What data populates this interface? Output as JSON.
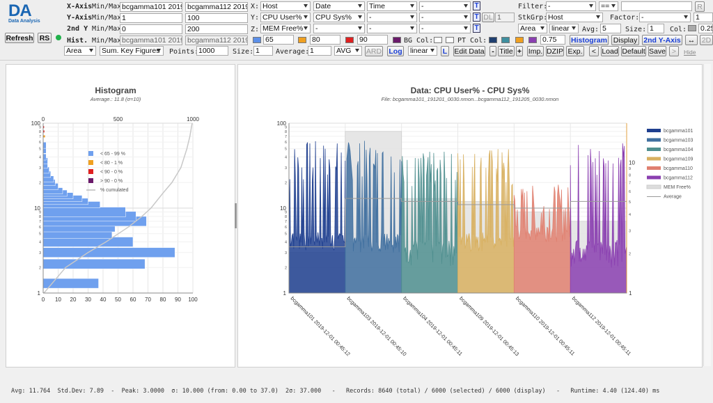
{
  "logo": {
    "text": "DA",
    "sub": "Data Analysis"
  },
  "buttons": {
    "refresh": "Refresh",
    "rs": "RS",
    "t": "T",
    "dl": "DL",
    "histogram": "Histogram",
    "display": "Display",
    "second_y": "2nd Y-Axis",
    "arrows": "↔",
    "twod": "2D",
    "r": "R",
    "ard": "ARD",
    "log": "Log",
    "l": "L",
    "edit_data": "Edit Data",
    "minus": "-",
    "title": "Title",
    "plus": "+",
    "imp": "Imp.",
    "dzip": "DZIP",
    "exp": "Exp.",
    "lt": "<",
    "load": "Load",
    "default": "Default",
    "save": "Save",
    "gt": ">",
    "hide": "Hide"
  },
  "axes_rows": [
    {
      "label": "X-Axis",
      "minmax": "Min/Max",
      "min": "bcgamma101 2019-",
      "max": "bcgamma112 2019-",
      "min_grey": false
    },
    {
      "label": "Y-Axis",
      "minmax": "Min/Max",
      "min": "1",
      "max": "100",
      "min_grey": false
    },
    {
      "label": "2nd Y",
      "minmax": "Min/Max",
      "min": "0",
      "max": "200",
      "min_grey": false
    },
    {
      "label": "Hist.",
      "minmax": "Min/Max",
      "min": "bcgamma101 2019-",
      "max": "bcgamma112 2019-",
      "min_grey": true
    }
  ],
  "xyz": {
    "x_label": "X:",
    "y_label": "Y:",
    "z_label": "Z:",
    "x": [
      "Host",
      "Date",
      "Time",
      "-"
    ],
    "y": [
      "CPU User%",
      "CPU Sys%",
      "-",
      "-"
    ],
    "z": [
      "MEM Free%",
      "-",
      "-",
      "-"
    ],
    "dl_value": "1"
  },
  "filter": {
    "label": "Filter:",
    "field": "-",
    "op": "==",
    "value": ""
  },
  "stkgrp": {
    "label": "StkGrp:",
    "value": "Host",
    "factor_label": "Factor:",
    "factor": "-",
    "factor_value": "1"
  },
  "area_row": {
    "mode": "Area",
    "scale": "linear",
    "avg_label": "Avg:",
    "avg": "5",
    "size_label": "Size:",
    "size": "1",
    "col_label": "Col:",
    "col_value": "0.25"
  },
  "thresholds": {
    "v1": "65",
    "v2": "80",
    "v3": "90",
    "c1": "#5b8fe8",
    "c2": "#f0a020",
    "c3": "#e02020",
    "c4": "#6a1a6a",
    "bg_label": "BG Col:",
    "pt_label": "PT Col:",
    "pt_value": "0.75"
  },
  "row5": {
    "type": "Area",
    "keyfig": "Sum. Key Figures",
    "points_label": "Points:",
    "points": "1000",
    "size_label": "Size:",
    "size": "1",
    "average_label": "Average:",
    "average": "1",
    "agg": "AVG",
    "interp": "linear"
  },
  "histogram": {
    "title": "Histogram",
    "subtitle": "Average.: 11.8 (σ=10)",
    "top_ticks": [
      "0",
      "500",
      "1000"
    ],
    "bottom_ticks": [
      "0",
      "10",
      "20",
      "30",
      "40",
      "50",
      "60",
      "70",
      "80",
      "90",
      "100"
    ],
    "left_ticks": [
      "1",
      "10",
      "100"
    ],
    "left_minor": [
      "2",
      "3",
      "4",
      "5",
      "6",
      "7",
      "8",
      "9"
    ],
    "legend": [
      {
        "label": "< 65 - 99 %",
        "color": "#6fa0ee"
      },
      {
        "label": "< 80 - 1 %",
        "color": "#f0a020"
      },
      {
        "label": "< 90 - 0 %",
        "color": "#e02020"
      },
      {
        "label": "> 90 - 0 %",
        "color": "#6a1a6a"
      },
      {
        "label": "% cumulated",
        "color": "#bbbbbb"
      }
    ]
  },
  "main_chart": {
    "title": "Data: CPU User% - CPU Sys%",
    "subtitle": "File: bcgamma101_191201_0030.nmon...bcgamma112_191205_0030.nmon",
    "left_ticks": [
      "1",
      "10",
      "100"
    ],
    "left_minor": [
      "2",
      "3",
      "4",
      "5",
      "6",
      "7",
      "8",
      "9"
    ],
    "right_ticks": [
      "1",
      "10"
    ],
    "right_minor": [
      "2",
      "3",
      "4",
      "5",
      "6",
      "7",
      "8",
      "9"
    ],
    "x_labels": [
      "bcgamma101 2019-12-01 00:45:12",
      "bcgamma103 2019-12-01 00:45:10",
      "bcgamma104 2019-12-01 00:45:11",
      "bcgamma109 2019-12-01 00:45:13",
      "bcgamma110 2019-12-01 00:45:11",
      "bcgamma112 2019-12-01 00:45:11"
    ],
    "legend": [
      {
        "label": "bcgamma101",
        "color": "#1f3f8f"
      },
      {
        "label": "bcgamma103",
        "color": "#3f6f9f"
      },
      {
        "label": "bcgamma104",
        "color": "#4f8f8f"
      },
      {
        "label": "bcgamma109",
        "color": "#d8b060"
      },
      {
        "label": "bcgamma110",
        "color": "#e08070"
      },
      {
        "label": "bcgamma112",
        "color": "#8a3fb0"
      },
      {
        "label": "MEM Free%",
        "color": "#dddddd"
      },
      {
        "label": "Average",
        "color": "#999999"
      }
    ]
  },
  "chart_data": [
    {
      "type": "bar",
      "title": "Histogram",
      "subtitle": "Average.: 11.8 (σ=10)",
      "orientation": "horizontal",
      "xlim": [
        0,
        100
      ],
      "y_scale": "log",
      "ylim": [
        1,
        100
      ],
      "bins": [
        {
          "y": 1.3,
          "value": 37
        },
        {
          "y": 2.2,
          "value": 68
        },
        {
          "y": 3.0,
          "value": 88
        },
        {
          "y": 4.0,
          "value": 60
        },
        {
          "y": 5.0,
          "value": 46
        },
        {
          "y": 6.0,
          "value": 48
        },
        {
          "y": 7.0,
          "value": 69
        },
        {
          "y": 8.0,
          "value": 62
        },
        {
          "y": 9.0,
          "value": 55
        },
        {
          "y": 11,
          "value": 38
        },
        {
          "y": 12,
          "value": 30
        },
        {
          "y": 13,
          "value": 26
        },
        {
          "y": 14,
          "value": 20
        },
        {
          "y": 15,
          "value": 16
        },
        {
          "y": 16,
          "value": 13
        },
        {
          "y": 18,
          "value": 10
        },
        {
          "y": 20,
          "value": 8
        },
        {
          "y": 22,
          "value": 7
        },
        {
          "y": 25,
          "value": 5
        },
        {
          "y": 28,
          "value": 4
        },
        {
          "y": 32,
          "value": 3
        },
        {
          "y": 36,
          "value": 3
        },
        {
          "y": 40,
          "value": 2
        },
        {
          "y": 48,
          "value": 2
        },
        {
          "y": 55,
          "value": 2
        }
      ],
      "legend": [
        "< 65 - 99 %",
        "< 80 - 1 %",
        "< 90 - 0 %",
        "> 90 - 0 %",
        "% cumulated"
      ],
      "grid": true,
      "legend_position": "top-left"
    },
    {
      "type": "area",
      "title": "Data: CPU User% - CPU Sys%",
      "subtitle": "File: bcgamma101_191201_0030.nmon...bcgamma112_191205_0030.nmon",
      "y_scale": "log",
      "ylim": [
        1,
        100
      ],
      "y2_scale": "log",
      "categories": [
        "bcgamma101 2019-12-01 00:45:12",
        "bcgamma103 2019-12-01 00:45:10",
        "bcgamma104 2019-12-01 00:45:11",
        "bcgamma109 2019-12-01 00:45:13",
        "bcgamma110 2019-12-01 00:45:11",
        "bcgamma112 2019-12-01 00:45:11"
      ],
      "series": [
        {
          "name": "bcgamma101",
          "base": 3,
          "peak": 60
        },
        {
          "name": "bcgamma103",
          "base": 3,
          "peak": 60
        },
        {
          "name": "bcgamma104",
          "base": 2,
          "peak": 45
        },
        {
          "name": "bcgamma109",
          "base": 3,
          "peak": 50
        },
        {
          "name": "bcgamma110",
          "base": 4,
          "peak": 15
        },
        {
          "name": "bcgamma112",
          "base": 2,
          "peak": 60
        },
        {
          "name": "MEM Free%",
          "values": [
            3,
            80,
            13,
            12,
            9,
            7
          ]
        },
        {
          "name": "Average",
          "values": [
            3.5,
            13,
            12,
            11,
            10,
            12
          ]
        }
      ],
      "legend_position": "right",
      "grid": true
    }
  ],
  "status": "Avg: 11.764  Std.Dev: 7.89  -  Peak: 3.0000  σ: 10.000 (from: 0.00 to 37.0)  2σ: 37.000   -   Records: 8640 (total) / 6000 (selected) / 6000 (display)   -   Runtime: 4.40 (124.40) ms"
}
